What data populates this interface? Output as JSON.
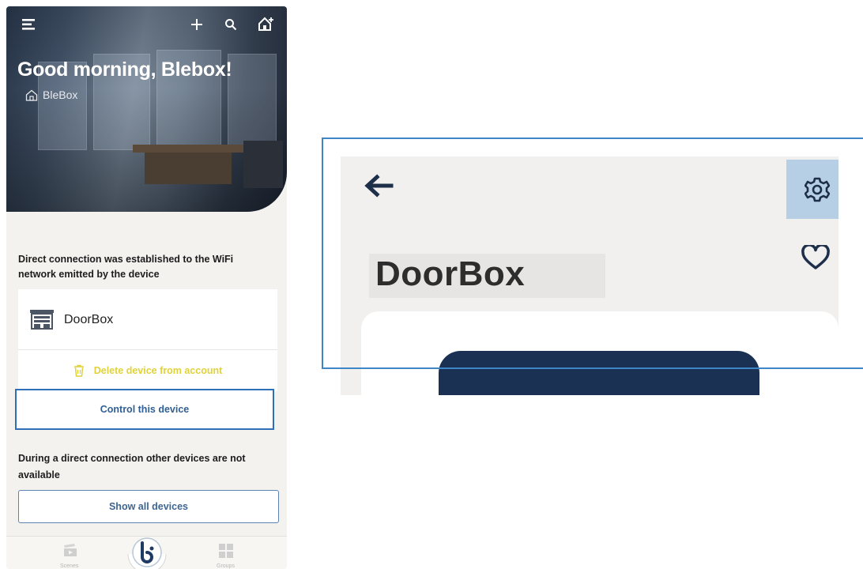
{
  "phone": {
    "greeting": "Good morning, Blebox!",
    "home_name": "BleBox",
    "direct_connection_message": "Direct connection was established to the WiFi network emitted by the device",
    "device_name": "DoorBox",
    "delete_label": "Delete device from account",
    "control_label": "Control this device",
    "other_devices_message": "During a direct connection other devices are not available",
    "show_all_label": "Show all devices",
    "nav": {
      "scenes": "Scenes",
      "groups": "Groups"
    }
  },
  "zoom": {
    "device_title": "DoorBox"
  },
  "colors": {
    "accent_blue": "#2f6fb8",
    "delete_yellow": "#e0d23a",
    "dark_button": "#1a3154",
    "gear_highlight": "#b7cfe4"
  },
  "icons": [
    "menu-icon",
    "plus-icon",
    "search-icon",
    "add-home-icon",
    "home-icon",
    "doorbox-device-icon",
    "trash-icon",
    "scenes-icon",
    "blebox-logo-icon",
    "groups-icon",
    "arrow-left-icon",
    "gear-icon",
    "heart-icon"
  ]
}
